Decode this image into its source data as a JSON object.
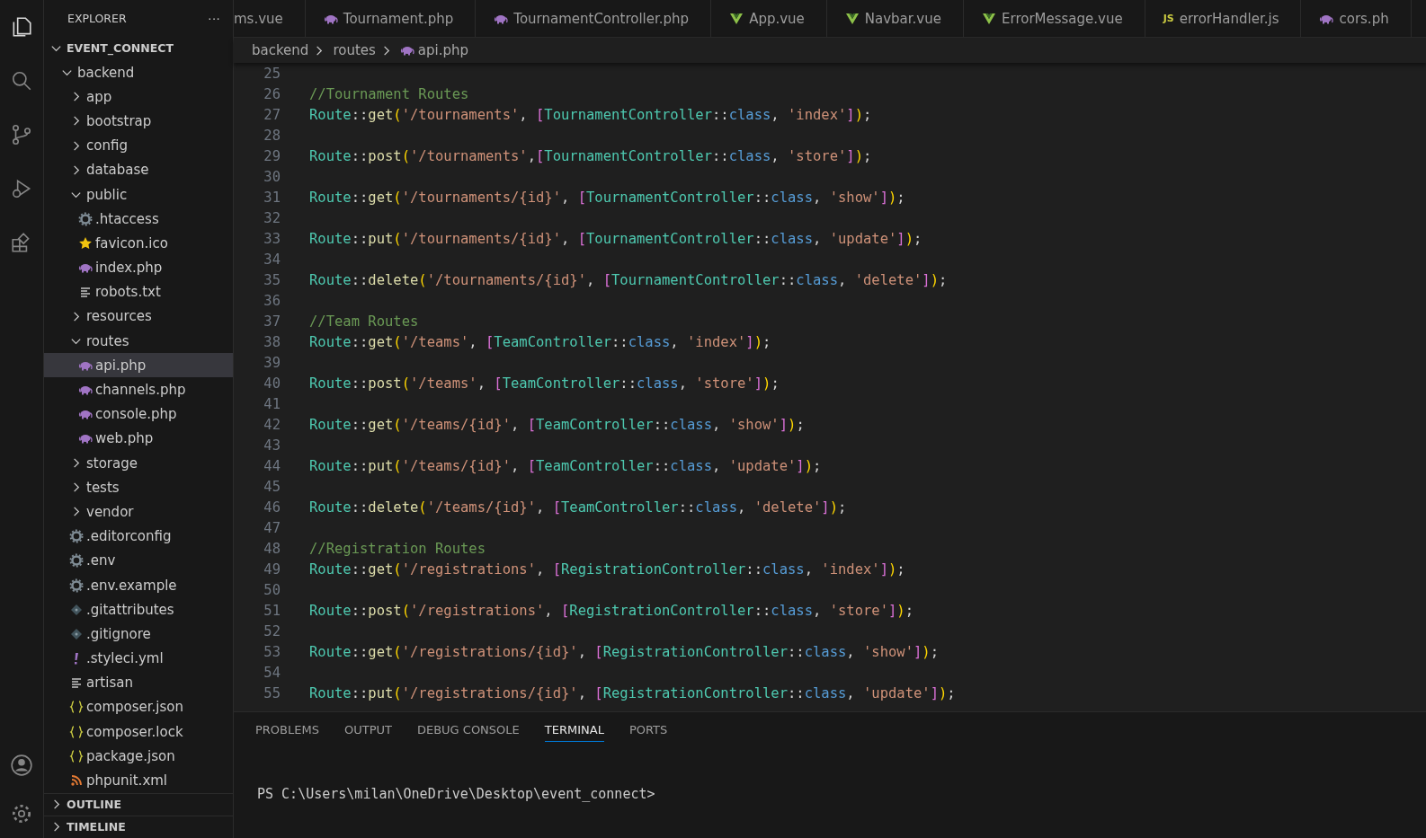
{
  "sidebar": {
    "title": "EXPLORER",
    "more": "···",
    "root": {
      "label": "EVENT_CONNECT",
      "expanded": true
    },
    "tree": [
      {
        "label": "backend",
        "kind": "folder",
        "expanded": true,
        "selected": false,
        "children": [
          {
            "label": "app",
            "kind": "folder",
            "expanded": false,
            "selected": false
          },
          {
            "label": "bootstrap",
            "kind": "folder",
            "expanded": false,
            "selected": false
          },
          {
            "label": "config",
            "kind": "folder",
            "expanded": false,
            "selected": false
          },
          {
            "label": "database",
            "kind": "folder",
            "expanded": false,
            "selected": false
          },
          {
            "label": "public",
            "kind": "folder",
            "expanded": true,
            "selected": false,
            "children": [
              {
                "label": ".htaccess",
                "kind": "gear",
                "selected": false
              },
              {
                "label": "favicon.ico",
                "kind": "star",
                "selected": false
              },
              {
                "label": "index.php",
                "kind": "php",
                "selected": false
              },
              {
                "label": "robots.txt",
                "kind": "text",
                "selected": false
              }
            ]
          },
          {
            "label": "resources",
            "kind": "folder",
            "expanded": false,
            "selected": false
          },
          {
            "label": "routes",
            "kind": "folder",
            "expanded": true,
            "selected": false,
            "children": [
              {
                "label": "api.php",
                "kind": "php",
                "selected": true
              },
              {
                "label": "channels.php",
                "kind": "php",
                "selected": false
              },
              {
                "label": "console.php",
                "kind": "php",
                "selected": false
              },
              {
                "label": "web.php",
                "kind": "php",
                "selected": false
              }
            ]
          },
          {
            "label": "storage",
            "kind": "folder",
            "expanded": false,
            "selected": false
          },
          {
            "label": "tests",
            "kind": "folder",
            "expanded": false,
            "selected": false
          },
          {
            "label": "vendor",
            "kind": "folder",
            "expanded": false,
            "selected": false
          },
          {
            "label": ".editorconfig",
            "kind": "gear",
            "selected": false
          },
          {
            "label": ".env",
            "kind": "gear",
            "selected": false
          },
          {
            "label": ".env.example",
            "kind": "gear",
            "selected": false
          },
          {
            "label": ".gitattributes",
            "kind": "git",
            "selected": false
          },
          {
            "label": ".gitignore",
            "kind": "git",
            "selected": false
          },
          {
            "label": ".styleci.yml",
            "kind": "yaml",
            "selected": false
          },
          {
            "label": "artisan",
            "kind": "text",
            "selected": false
          },
          {
            "label": "composer.json",
            "kind": "json",
            "selected": false
          },
          {
            "label": "composer.lock",
            "kind": "json",
            "selected": false
          },
          {
            "label": "package.json",
            "kind": "json",
            "selected": false
          },
          {
            "label": "phpunit.xml",
            "kind": "rss",
            "selected": false
          }
        ]
      }
    ],
    "sections": [
      {
        "label": "OUTLINE",
        "expanded": false
      },
      {
        "label": "TIMELINE",
        "expanded": false
      }
    ]
  },
  "tabs": [
    {
      "label": "ms.vue",
      "kind": "none"
    },
    {
      "label": "Tournament.php",
      "kind": "php"
    },
    {
      "label": "TournamentController.php",
      "kind": "php"
    },
    {
      "label": "App.vue",
      "kind": "vue"
    },
    {
      "label": "Navbar.vue",
      "kind": "vue"
    },
    {
      "label": "ErrorMessage.vue",
      "kind": "vue"
    },
    {
      "label": "errorHandler.js",
      "kind": "js",
      "icon_text": "JS"
    },
    {
      "label": "cors.ph",
      "kind": "php"
    }
  ],
  "breadcrumb": [
    {
      "label": "backend",
      "kind": "folder"
    },
    {
      "label": "routes",
      "kind": "folder"
    },
    {
      "label": "api.php",
      "kind": "php"
    }
  ],
  "code": [
    {
      "n": "25"
    },
    {
      "n": "26",
      "tokens": [
        {
          "text": "//Tournament Routes",
          "kind": "cm"
        }
      ]
    },
    {
      "n": "27",
      "tokens": [
        {
          "text": "Route",
          "kind": "ty"
        },
        {
          "text": "::",
          "kind": "op"
        },
        {
          "text": "get",
          "kind": "fn"
        },
        {
          "text": "(",
          "kind": "b1"
        },
        {
          "text": "'/tournaments'",
          "kind": "st"
        },
        {
          "text": ", ",
          "kind": "op"
        },
        {
          "text": "[",
          "kind": "b2"
        },
        {
          "text": "TournamentController",
          "kind": "ty"
        },
        {
          "text": "::",
          "kind": "op"
        },
        {
          "text": "class",
          "kind": "kw"
        },
        {
          "text": ", ",
          "kind": "op"
        },
        {
          "text": "'index'",
          "kind": "st"
        },
        {
          "text": "]",
          "kind": "b2"
        },
        {
          "text": ")",
          "kind": "b1"
        },
        {
          "text": ";",
          "kind": "op"
        }
      ]
    },
    {
      "n": "28"
    },
    {
      "n": "29",
      "tokens": [
        {
          "text": "Route",
          "kind": "ty"
        },
        {
          "text": "::",
          "kind": "op"
        },
        {
          "text": "post",
          "kind": "fn"
        },
        {
          "text": "(",
          "kind": "b1"
        },
        {
          "text": "'/tournaments'",
          "kind": "st"
        },
        {
          "text": ",",
          "kind": "op"
        },
        {
          "text": "[",
          "kind": "b2"
        },
        {
          "text": "TournamentController",
          "kind": "ty"
        },
        {
          "text": "::",
          "kind": "op"
        },
        {
          "text": "class",
          "kind": "kw"
        },
        {
          "text": ", ",
          "kind": "op"
        },
        {
          "text": "'store'",
          "kind": "st"
        },
        {
          "text": "]",
          "kind": "b2"
        },
        {
          "text": ")",
          "kind": "b1"
        },
        {
          "text": ";",
          "kind": "op"
        }
      ]
    },
    {
      "n": "30"
    },
    {
      "n": "31",
      "tokens": [
        {
          "text": "Route",
          "kind": "ty"
        },
        {
          "text": "::",
          "kind": "op"
        },
        {
          "text": "get",
          "kind": "fn"
        },
        {
          "text": "(",
          "kind": "b1"
        },
        {
          "text": "'/tournaments/{id}'",
          "kind": "st"
        },
        {
          "text": ", ",
          "kind": "op"
        },
        {
          "text": "[",
          "kind": "b2"
        },
        {
          "text": "TournamentController",
          "kind": "ty"
        },
        {
          "text": "::",
          "kind": "op"
        },
        {
          "text": "class",
          "kind": "kw"
        },
        {
          "text": ", ",
          "kind": "op"
        },
        {
          "text": "'show'",
          "kind": "st"
        },
        {
          "text": "]",
          "kind": "b2"
        },
        {
          "text": ")",
          "kind": "b1"
        },
        {
          "text": ";",
          "kind": "op"
        }
      ]
    },
    {
      "n": "32"
    },
    {
      "n": "33",
      "tokens": [
        {
          "text": "Route",
          "kind": "ty"
        },
        {
          "text": "::",
          "kind": "op"
        },
        {
          "text": "put",
          "kind": "fn"
        },
        {
          "text": "(",
          "kind": "b1"
        },
        {
          "text": "'/tournaments/{id}'",
          "kind": "st"
        },
        {
          "text": ", ",
          "kind": "op"
        },
        {
          "text": "[",
          "kind": "b2"
        },
        {
          "text": "TournamentController",
          "kind": "ty"
        },
        {
          "text": "::",
          "kind": "op"
        },
        {
          "text": "class",
          "kind": "kw"
        },
        {
          "text": ", ",
          "kind": "op"
        },
        {
          "text": "'update'",
          "kind": "st"
        },
        {
          "text": "]",
          "kind": "b2"
        },
        {
          "text": ")",
          "kind": "b1"
        },
        {
          "text": ";",
          "kind": "op"
        }
      ]
    },
    {
      "n": "34"
    },
    {
      "n": "35",
      "tokens": [
        {
          "text": "Route",
          "kind": "ty"
        },
        {
          "text": "::",
          "kind": "op"
        },
        {
          "text": "delete",
          "kind": "fn"
        },
        {
          "text": "(",
          "kind": "b1"
        },
        {
          "text": "'/tournaments/{id}'",
          "kind": "st"
        },
        {
          "text": ", ",
          "kind": "op"
        },
        {
          "text": "[",
          "kind": "b2"
        },
        {
          "text": "TournamentController",
          "kind": "ty"
        },
        {
          "text": "::",
          "kind": "op"
        },
        {
          "text": "class",
          "kind": "kw"
        },
        {
          "text": ", ",
          "kind": "op"
        },
        {
          "text": "'delete'",
          "kind": "st"
        },
        {
          "text": "]",
          "kind": "b2"
        },
        {
          "text": ")",
          "kind": "b1"
        },
        {
          "text": ";",
          "kind": "op"
        }
      ]
    },
    {
      "n": "36"
    },
    {
      "n": "37",
      "tokens": [
        {
          "text": "//Team Routes",
          "kind": "cm"
        }
      ]
    },
    {
      "n": "38",
      "tokens": [
        {
          "text": "Route",
          "kind": "ty"
        },
        {
          "text": "::",
          "kind": "op"
        },
        {
          "text": "get",
          "kind": "fn"
        },
        {
          "text": "(",
          "kind": "b1"
        },
        {
          "text": "'/teams'",
          "kind": "st"
        },
        {
          "text": ", ",
          "kind": "op"
        },
        {
          "text": "[",
          "kind": "b2"
        },
        {
          "text": "TeamController",
          "kind": "ty"
        },
        {
          "text": "::",
          "kind": "op"
        },
        {
          "text": "class",
          "kind": "kw"
        },
        {
          "text": ", ",
          "kind": "op"
        },
        {
          "text": "'index'",
          "kind": "st"
        },
        {
          "text": "]",
          "kind": "b2"
        },
        {
          "text": ")",
          "kind": "b1"
        },
        {
          "text": ";",
          "kind": "op"
        }
      ]
    },
    {
      "n": "39"
    },
    {
      "n": "40",
      "tokens": [
        {
          "text": "Route",
          "kind": "ty"
        },
        {
          "text": "::",
          "kind": "op"
        },
        {
          "text": "post",
          "kind": "fn"
        },
        {
          "text": "(",
          "kind": "b1"
        },
        {
          "text": "'/teams'",
          "kind": "st"
        },
        {
          "text": ", ",
          "kind": "op"
        },
        {
          "text": "[",
          "kind": "b2"
        },
        {
          "text": "TeamController",
          "kind": "ty"
        },
        {
          "text": "::",
          "kind": "op"
        },
        {
          "text": "class",
          "kind": "kw"
        },
        {
          "text": ", ",
          "kind": "op"
        },
        {
          "text": "'store'",
          "kind": "st"
        },
        {
          "text": "]",
          "kind": "b2"
        },
        {
          "text": ")",
          "kind": "b1"
        },
        {
          "text": ";",
          "kind": "op"
        }
      ]
    },
    {
      "n": "41"
    },
    {
      "n": "42",
      "tokens": [
        {
          "text": "Route",
          "kind": "ty"
        },
        {
          "text": "::",
          "kind": "op"
        },
        {
          "text": "get",
          "kind": "fn"
        },
        {
          "text": "(",
          "kind": "b1"
        },
        {
          "text": "'/teams/{id}'",
          "kind": "st"
        },
        {
          "text": ", ",
          "kind": "op"
        },
        {
          "text": "[",
          "kind": "b2"
        },
        {
          "text": "TeamController",
          "kind": "ty"
        },
        {
          "text": "::",
          "kind": "op"
        },
        {
          "text": "class",
          "kind": "kw"
        },
        {
          "text": ", ",
          "kind": "op"
        },
        {
          "text": "'show'",
          "kind": "st"
        },
        {
          "text": "]",
          "kind": "b2"
        },
        {
          "text": ")",
          "kind": "b1"
        },
        {
          "text": ";",
          "kind": "op"
        }
      ]
    },
    {
      "n": "43"
    },
    {
      "n": "44",
      "tokens": [
        {
          "text": "Route",
          "kind": "ty"
        },
        {
          "text": "::",
          "kind": "op"
        },
        {
          "text": "put",
          "kind": "fn"
        },
        {
          "text": "(",
          "kind": "b1"
        },
        {
          "text": "'/teams/{id}'",
          "kind": "st"
        },
        {
          "text": ", ",
          "kind": "op"
        },
        {
          "text": "[",
          "kind": "b2"
        },
        {
          "text": "TeamController",
          "kind": "ty"
        },
        {
          "text": "::",
          "kind": "op"
        },
        {
          "text": "class",
          "kind": "kw"
        },
        {
          "text": ", ",
          "kind": "op"
        },
        {
          "text": "'update'",
          "kind": "st"
        },
        {
          "text": "]",
          "kind": "b2"
        },
        {
          "text": ")",
          "kind": "b1"
        },
        {
          "text": ";",
          "kind": "op"
        }
      ]
    },
    {
      "n": "45"
    },
    {
      "n": "46",
      "tokens": [
        {
          "text": "Route",
          "kind": "ty"
        },
        {
          "text": "::",
          "kind": "op"
        },
        {
          "text": "delete",
          "kind": "fn"
        },
        {
          "text": "(",
          "kind": "b1"
        },
        {
          "text": "'/teams/{id}'",
          "kind": "st"
        },
        {
          "text": ", ",
          "kind": "op"
        },
        {
          "text": "[",
          "kind": "b2"
        },
        {
          "text": "TeamController",
          "kind": "ty"
        },
        {
          "text": "::",
          "kind": "op"
        },
        {
          "text": "class",
          "kind": "kw"
        },
        {
          "text": ", ",
          "kind": "op"
        },
        {
          "text": "'delete'",
          "kind": "st"
        },
        {
          "text": "]",
          "kind": "b2"
        },
        {
          "text": ")",
          "kind": "b1"
        },
        {
          "text": ";",
          "kind": "op"
        }
      ]
    },
    {
      "n": "47"
    },
    {
      "n": "48",
      "tokens": [
        {
          "text": "//Registration Routes",
          "kind": "cm"
        }
      ]
    },
    {
      "n": "49",
      "tokens": [
        {
          "text": "Route",
          "kind": "ty"
        },
        {
          "text": "::",
          "kind": "op"
        },
        {
          "text": "get",
          "kind": "fn"
        },
        {
          "text": "(",
          "kind": "b1"
        },
        {
          "text": "'/registrations'",
          "kind": "st"
        },
        {
          "text": ", ",
          "kind": "op"
        },
        {
          "text": "[",
          "kind": "b2"
        },
        {
          "text": "RegistrationController",
          "kind": "ty"
        },
        {
          "text": "::",
          "kind": "op"
        },
        {
          "text": "class",
          "kind": "kw"
        },
        {
          "text": ", ",
          "kind": "op"
        },
        {
          "text": "'index'",
          "kind": "st"
        },
        {
          "text": "]",
          "kind": "b2"
        },
        {
          "text": ")",
          "kind": "b1"
        },
        {
          "text": ";",
          "kind": "op"
        }
      ]
    },
    {
      "n": "50"
    },
    {
      "n": "51",
      "tokens": [
        {
          "text": "Route",
          "kind": "ty"
        },
        {
          "text": "::",
          "kind": "op"
        },
        {
          "text": "post",
          "kind": "fn"
        },
        {
          "text": "(",
          "kind": "b1"
        },
        {
          "text": "'/registrations'",
          "kind": "st"
        },
        {
          "text": ", ",
          "kind": "op"
        },
        {
          "text": "[",
          "kind": "b2"
        },
        {
          "text": "RegistrationController",
          "kind": "ty"
        },
        {
          "text": "::",
          "kind": "op"
        },
        {
          "text": "class",
          "kind": "kw"
        },
        {
          "text": ", ",
          "kind": "op"
        },
        {
          "text": "'store'",
          "kind": "st"
        },
        {
          "text": "]",
          "kind": "b2"
        },
        {
          "text": ")",
          "kind": "b1"
        },
        {
          "text": ";",
          "kind": "op"
        }
      ]
    },
    {
      "n": "52"
    },
    {
      "n": "53",
      "tokens": [
        {
          "text": "Route",
          "kind": "ty"
        },
        {
          "text": "::",
          "kind": "op"
        },
        {
          "text": "get",
          "kind": "fn"
        },
        {
          "text": "(",
          "kind": "b1"
        },
        {
          "text": "'/registrations/{id}'",
          "kind": "st"
        },
        {
          "text": ", ",
          "kind": "op"
        },
        {
          "text": "[",
          "kind": "b2"
        },
        {
          "text": "RegistrationController",
          "kind": "ty"
        },
        {
          "text": "::",
          "kind": "op"
        },
        {
          "text": "class",
          "kind": "kw"
        },
        {
          "text": ", ",
          "kind": "op"
        },
        {
          "text": "'show'",
          "kind": "st"
        },
        {
          "text": "]",
          "kind": "b2"
        },
        {
          "text": ")",
          "kind": "b1"
        },
        {
          "text": ";",
          "kind": "op"
        }
      ]
    },
    {
      "n": "54"
    },
    {
      "n": "55",
      "tokens": [
        {
          "text": "Route",
          "kind": "ty"
        },
        {
          "text": "::",
          "kind": "op"
        },
        {
          "text": "put",
          "kind": "fn"
        },
        {
          "text": "(",
          "kind": "b1"
        },
        {
          "text": "'/registrations/{id}'",
          "kind": "st"
        },
        {
          "text": ", ",
          "kind": "op"
        },
        {
          "text": "[",
          "kind": "b2"
        },
        {
          "text": "RegistrationController",
          "kind": "ty"
        },
        {
          "text": "::",
          "kind": "op"
        },
        {
          "text": "class",
          "kind": "kw"
        },
        {
          "text": ", ",
          "kind": "op"
        },
        {
          "text": "'update'",
          "kind": "st"
        },
        {
          "text": "]",
          "kind": "b2"
        },
        {
          "text": ")",
          "kind": "b1"
        },
        {
          "text": ";",
          "kind": "op"
        }
      ]
    }
  ],
  "panel": {
    "tabs": [
      {
        "label": "PROBLEMS",
        "selected": false
      },
      {
        "label": "OUTPUT",
        "selected": false
      },
      {
        "label": "DEBUG CONSOLE",
        "selected": false
      },
      {
        "label": "TERMINAL",
        "selected": true
      },
      {
        "label": "PORTS",
        "selected": false
      }
    ],
    "prompt": "PS C:\\Users\\milan\\OneDrive\\Desktop\\event_connect>"
  }
}
